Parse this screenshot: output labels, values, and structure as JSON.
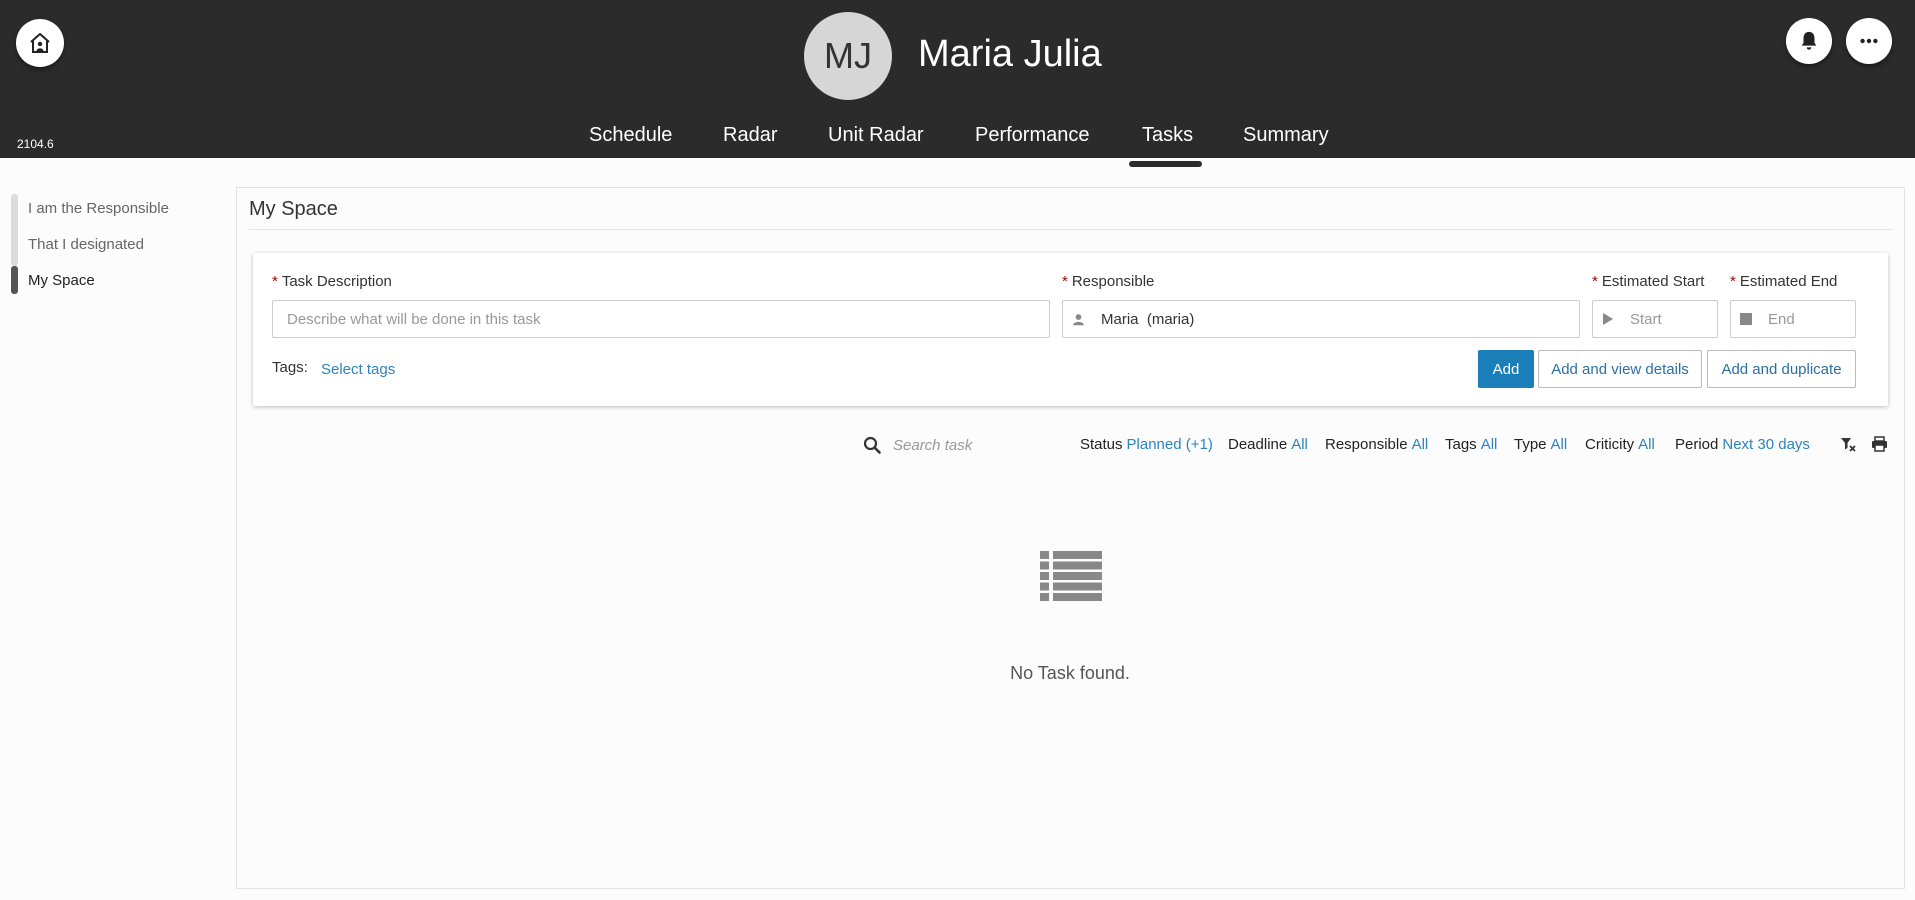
{
  "header": {
    "version": "2104.6",
    "avatar_initials": "MJ",
    "user_name": "Maria Julia",
    "home_icon": "home-icon",
    "notification_icon": "bell-icon",
    "more_icon": "ellipsis-icon",
    "nav": [
      {
        "label": "Schedule",
        "active": false
      },
      {
        "label": "Radar",
        "active": false
      },
      {
        "label": "Unit Radar",
        "active": false
      },
      {
        "label": "Performance",
        "active": false
      },
      {
        "label": "Tasks",
        "active": true
      },
      {
        "label": "Summary",
        "active": false
      }
    ]
  },
  "sidebar": {
    "items": [
      {
        "label": "I am the Responsible",
        "active": false
      },
      {
        "label": "That I designated",
        "active": false
      },
      {
        "label": "My Space",
        "active": true
      }
    ]
  },
  "panel": {
    "title": "My Space",
    "form": {
      "required_mark": "*",
      "task_description": {
        "label": "Task Description",
        "placeholder": "Describe what will be done in this task",
        "value": ""
      },
      "responsible": {
        "label": "Responsible",
        "value": "Maria  (maria)",
        "icon": "user-icon"
      },
      "estimated_start": {
        "label": "Estimated Start",
        "placeholder": "Start",
        "icon": "play-icon"
      },
      "estimated_end": {
        "label": "Estimated End",
        "placeholder": "End",
        "icon": "stop-icon"
      },
      "tags_label": "Tags:",
      "tags_link": "Select tags",
      "buttons": {
        "add": "Add",
        "add_view": "Add and view details",
        "add_duplicate": "Add and duplicate"
      }
    },
    "filters": {
      "search_placeholder": "Search task",
      "items": [
        {
          "key": "Status",
          "value": "Planned (+1)"
        },
        {
          "key": "Deadline",
          "value": "All"
        },
        {
          "key": "Responsible",
          "value": "All"
        },
        {
          "key": "Tags",
          "value": "All"
        },
        {
          "key": "Type",
          "value": "All"
        },
        {
          "key": "Criticity",
          "value": "All"
        },
        {
          "key": "Period",
          "value": "Next 30 days"
        }
      ],
      "clear_icon": "filter-clear-icon",
      "print_icon": "print-icon"
    },
    "empty": {
      "icon": "list-icon",
      "text": "No Task found."
    }
  },
  "colors": {
    "header_bg": "#2b2b2b",
    "accent": "#1a7fb8",
    "link": "#2c83bd",
    "required": "#aa0000"
  }
}
